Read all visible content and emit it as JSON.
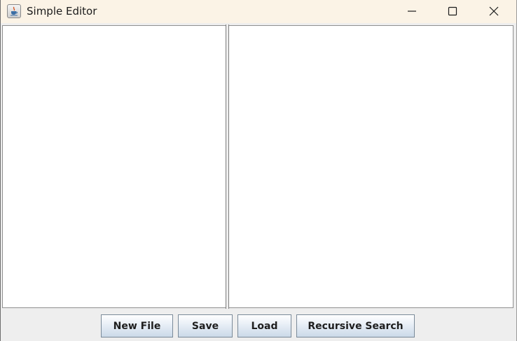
{
  "window": {
    "title": "Simple Editor",
    "icon": "java-cup-icon"
  },
  "title_controls": {
    "minimize_icon": "minimize-icon",
    "maximize_icon": "maximize-icon",
    "close_icon": "close-icon"
  },
  "buttons": {
    "new_file": "New File",
    "save": "Save",
    "load": "Load",
    "recursive_search": "Recursive Search"
  },
  "colors": {
    "titlebar": "#fbf3e6",
    "panel": "#eeeeee",
    "pane": "#ffffff",
    "button_bottom": "#cbd9e8"
  }
}
